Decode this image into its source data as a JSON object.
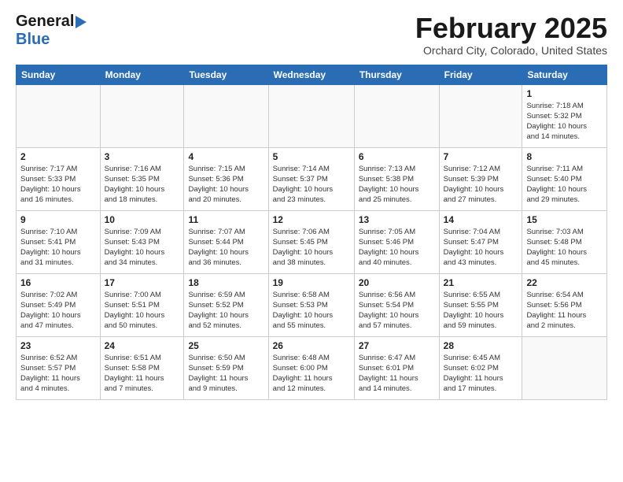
{
  "header": {
    "logo_line1": "General",
    "logo_line2": "Blue",
    "month_title": "February 2025",
    "location": "Orchard City, Colorado, United States"
  },
  "weekdays": [
    "Sunday",
    "Monday",
    "Tuesday",
    "Wednesday",
    "Thursday",
    "Friday",
    "Saturday"
  ],
  "weeks": [
    [
      {
        "day": "",
        "info": ""
      },
      {
        "day": "",
        "info": ""
      },
      {
        "day": "",
        "info": ""
      },
      {
        "day": "",
        "info": ""
      },
      {
        "day": "",
        "info": ""
      },
      {
        "day": "",
        "info": ""
      },
      {
        "day": "1",
        "info": "Sunrise: 7:18 AM\nSunset: 5:32 PM\nDaylight: 10 hours\nand 14 minutes."
      }
    ],
    [
      {
        "day": "2",
        "info": "Sunrise: 7:17 AM\nSunset: 5:33 PM\nDaylight: 10 hours\nand 16 minutes."
      },
      {
        "day": "3",
        "info": "Sunrise: 7:16 AM\nSunset: 5:35 PM\nDaylight: 10 hours\nand 18 minutes."
      },
      {
        "day": "4",
        "info": "Sunrise: 7:15 AM\nSunset: 5:36 PM\nDaylight: 10 hours\nand 20 minutes."
      },
      {
        "day": "5",
        "info": "Sunrise: 7:14 AM\nSunset: 5:37 PM\nDaylight: 10 hours\nand 23 minutes."
      },
      {
        "day": "6",
        "info": "Sunrise: 7:13 AM\nSunset: 5:38 PM\nDaylight: 10 hours\nand 25 minutes."
      },
      {
        "day": "7",
        "info": "Sunrise: 7:12 AM\nSunset: 5:39 PM\nDaylight: 10 hours\nand 27 minutes."
      },
      {
        "day": "8",
        "info": "Sunrise: 7:11 AM\nSunset: 5:40 PM\nDaylight: 10 hours\nand 29 minutes."
      }
    ],
    [
      {
        "day": "9",
        "info": "Sunrise: 7:10 AM\nSunset: 5:41 PM\nDaylight: 10 hours\nand 31 minutes."
      },
      {
        "day": "10",
        "info": "Sunrise: 7:09 AM\nSunset: 5:43 PM\nDaylight: 10 hours\nand 34 minutes."
      },
      {
        "day": "11",
        "info": "Sunrise: 7:07 AM\nSunset: 5:44 PM\nDaylight: 10 hours\nand 36 minutes."
      },
      {
        "day": "12",
        "info": "Sunrise: 7:06 AM\nSunset: 5:45 PM\nDaylight: 10 hours\nand 38 minutes."
      },
      {
        "day": "13",
        "info": "Sunrise: 7:05 AM\nSunset: 5:46 PM\nDaylight: 10 hours\nand 40 minutes."
      },
      {
        "day": "14",
        "info": "Sunrise: 7:04 AM\nSunset: 5:47 PM\nDaylight: 10 hours\nand 43 minutes."
      },
      {
        "day": "15",
        "info": "Sunrise: 7:03 AM\nSunset: 5:48 PM\nDaylight: 10 hours\nand 45 minutes."
      }
    ],
    [
      {
        "day": "16",
        "info": "Sunrise: 7:02 AM\nSunset: 5:49 PM\nDaylight: 10 hours\nand 47 minutes."
      },
      {
        "day": "17",
        "info": "Sunrise: 7:00 AM\nSunset: 5:51 PM\nDaylight: 10 hours\nand 50 minutes."
      },
      {
        "day": "18",
        "info": "Sunrise: 6:59 AM\nSunset: 5:52 PM\nDaylight: 10 hours\nand 52 minutes."
      },
      {
        "day": "19",
        "info": "Sunrise: 6:58 AM\nSunset: 5:53 PM\nDaylight: 10 hours\nand 55 minutes."
      },
      {
        "day": "20",
        "info": "Sunrise: 6:56 AM\nSunset: 5:54 PM\nDaylight: 10 hours\nand 57 minutes."
      },
      {
        "day": "21",
        "info": "Sunrise: 6:55 AM\nSunset: 5:55 PM\nDaylight: 10 hours\nand 59 minutes."
      },
      {
        "day": "22",
        "info": "Sunrise: 6:54 AM\nSunset: 5:56 PM\nDaylight: 11 hours\nand 2 minutes."
      }
    ],
    [
      {
        "day": "23",
        "info": "Sunrise: 6:52 AM\nSunset: 5:57 PM\nDaylight: 11 hours\nand 4 minutes."
      },
      {
        "day": "24",
        "info": "Sunrise: 6:51 AM\nSunset: 5:58 PM\nDaylight: 11 hours\nand 7 minutes."
      },
      {
        "day": "25",
        "info": "Sunrise: 6:50 AM\nSunset: 5:59 PM\nDaylight: 11 hours\nand 9 minutes."
      },
      {
        "day": "26",
        "info": "Sunrise: 6:48 AM\nSunset: 6:00 PM\nDaylight: 11 hours\nand 12 minutes."
      },
      {
        "day": "27",
        "info": "Sunrise: 6:47 AM\nSunset: 6:01 PM\nDaylight: 11 hours\nand 14 minutes."
      },
      {
        "day": "28",
        "info": "Sunrise: 6:45 AM\nSunset: 6:02 PM\nDaylight: 11 hours\nand 17 minutes."
      },
      {
        "day": "",
        "info": ""
      }
    ]
  ]
}
